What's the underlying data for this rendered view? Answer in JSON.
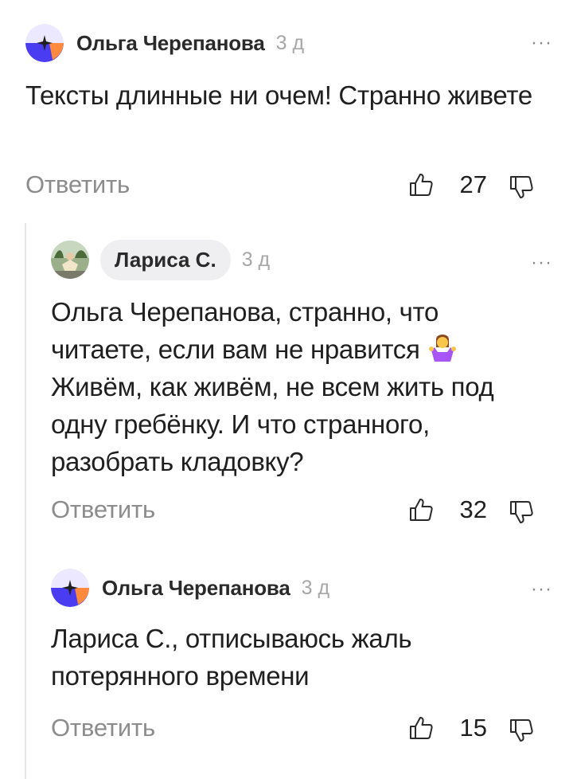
{
  "comments": [
    {
      "author": "Ольга Черепанова",
      "time": "3 д",
      "text": "Тексты длинные ни очем! Странно живете",
      "reply_label": "Ответить",
      "likes": "27",
      "more_label": "···"
    },
    {
      "author": "Лариса С.",
      "time": "3 д",
      "text_line1": "Ольга Черепанова, странно, что",
      "text_line2": "читаете, если вам не нравится",
      "text_rest": "Живём, как живём, не всем жить под одну гребёнку. И что странного, разобрать кладовку?",
      "reply_label": "Ответить",
      "likes": "32",
      "more_label": "···"
    },
    {
      "author": "Ольга Черепанова",
      "time": "3 д",
      "text": "Лариса С., отписываюсь жаль потерянного времени",
      "reply_label": "Ответить",
      "likes": "15",
      "more_label": "···"
    }
  ],
  "icons": {
    "like": "thumbs-up-icon",
    "dislike": "thumbs-down-icon",
    "more": "more-dots-icon",
    "emoji": "person-shrugging-emoji"
  },
  "colors": {
    "avatar_blue": "#4a3cf0",
    "avatar_orange": "#ff8a3d",
    "muted": "#8c8c8c",
    "time": "#a7a7a7"
  }
}
